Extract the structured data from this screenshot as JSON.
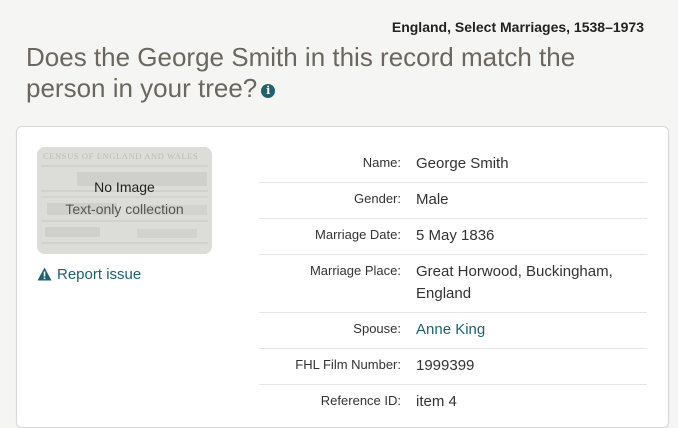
{
  "header": {
    "collection_title": "England, Select Marriages, 1538–1973",
    "question": "Does the George Smith in this record match the person in your tree?",
    "info_icon": "i"
  },
  "thumbnail": {
    "title": "No Image",
    "subtitle": "Text-only collection",
    "background_heading": "CENSUS OF ENGLAND AND WALES"
  },
  "report_issue": {
    "label": "Report issue",
    "icon": "warning-icon"
  },
  "record": [
    {
      "label": "Name:",
      "value": "George Smith",
      "link": false
    },
    {
      "label": "Gender:",
      "value": "Male",
      "link": false
    },
    {
      "label": "Marriage Date:",
      "value": "5 May 1836",
      "link": false
    },
    {
      "label": "Marriage Place:",
      "value": "Great Horwood, Buckingham, England",
      "link": false
    },
    {
      "label": "Spouse:",
      "value": "Anne King",
      "link": true
    },
    {
      "label": "FHL Film Number:",
      "value": "1999399",
      "link": false
    },
    {
      "label": "Reference ID:",
      "value": "item 4",
      "link": false
    }
  ],
  "colors": {
    "accent": "#22606e",
    "heading": "#6b675e",
    "background": "#f5f5f4"
  }
}
